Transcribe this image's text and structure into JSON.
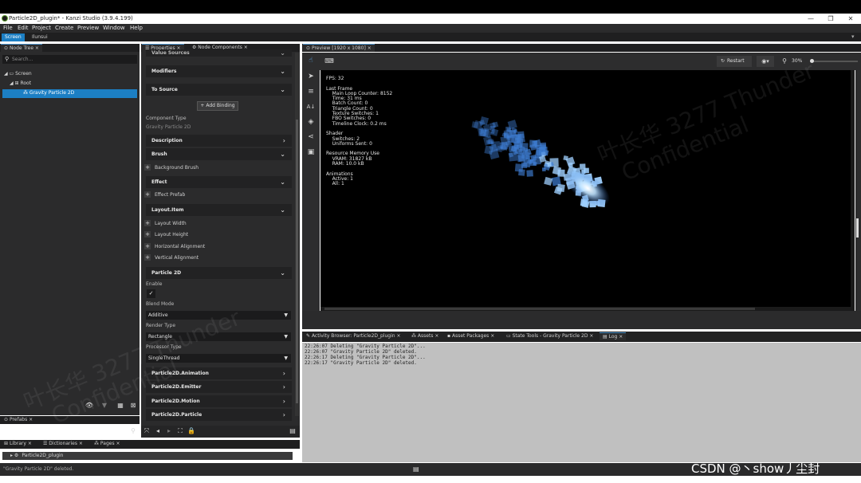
{
  "window": {
    "title": "Particle2D_plugin* - Kanzi Studio (3.9.4.199)",
    "minimize": "—",
    "maximize": "❐",
    "close": "✕"
  },
  "menu": [
    "File",
    "Edit",
    "Project",
    "Create",
    "Preview",
    "Window",
    "Help"
  ],
  "modes": {
    "active": "Screen",
    "other": "Ilunsui"
  },
  "node_tree": {
    "tab": "Node Tree",
    "search_placeholder": "Search...",
    "items": [
      {
        "label": "Screen"
      },
      {
        "label": "Root"
      },
      {
        "label": "Gravity Particle 2D"
      }
    ]
  },
  "prefabs_tab": "Prefabs",
  "properties": {
    "tabs": [
      "Properties",
      "Node Components"
    ],
    "partial_header": "Value Sources",
    "modifiers": "Modifiers",
    "to_source": "To Source",
    "add_binding": "+ Add Binding",
    "component_type_label": "Component Type",
    "component_type_value": "Gravity Particle 2D",
    "description": "Description",
    "brush": "Brush",
    "background_brush": "Background Brush",
    "effect": "Effect",
    "effect_prefab": "Effect Prefab",
    "layout_item": "Layout.Item",
    "layout_width": "Layout Width",
    "layout_height": "Layout Height",
    "horizontal_alignment": "Horizontal Alignment",
    "vertical_alignment": "Vertical Alignment",
    "particle_2d": "Particle 2D",
    "enable_label": "Enable",
    "blend_mode_label": "Blend Mode",
    "blend_mode_value": "Additive",
    "render_type_label": "Render Type",
    "render_type_value": "Rectangle",
    "processor_type_label": "Processor Type",
    "processor_type_value": "SingleThread",
    "animation": "Particle2D.Animation",
    "emitter": "Particle2D.Emitter",
    "motion": "Particle2D.Motion",
    "particle": "Particle2D.Particle"
  },
  "preview": {
    "tab": "Preview [1920 x 1080]",
    "restart": "Restart",
    "zoom": "30%",
    "stats": "FPS: 32\n\nLast Frame\n    Main Loop Counter: 8152\n    Time: 31 ms\n    Batch Count: 0\n    Triangle Count: 0\n    Texture Switches: 1\n    FBO Switches: 0\n    Timeline Clock: 0.2 ms\n\nShader\n    Switches: 2\n    Uniforms Sent: 0\n\nResource Memory Use\n    VRAM: 31827 kB\n    RAM: 10.0 kB\n\nAnimations\n    Active: 1\n    All: 1"
  },
  "bottom_tabs": [
    "Activity Browser: Particle2D_plugin",
    "Assets",
    "Asset Packages",
    "State Tools - Gravity Particle 2D",
    "Log"
  ],
  "log_lines": [
    "22:26:07 Deleting \"Gravity Particle 2D\"...",
    "22:26:07 \"Gravity Particle 2D\" deleted.",
    "22:26:17 Deleting \"Gravity Particle 2D\"...",
    "22:26:17 \"Gravity Particle 2D\" deleted."
  ],
  "library": {
    "tabs": [
      "Library",
      "Dictionaries",
      "Pages"
    ],
    "item": "Particle2D_plugin"
  },
  "status_text": "\"Gravity Particle 2D\" deleted.",
  "watermarks": [
    "叶长华 3277 Thunder",
    "Confidential"
  ],
  "csdn_mark": "CSDN @丶show丿尘封",
  "colors": {
    "accent": "#1c7fc4",
    "panel": "#2a2a2b",
    "log_bg": "#c0c0c0",
    "particle": "#6fb4ff"
  }
}
